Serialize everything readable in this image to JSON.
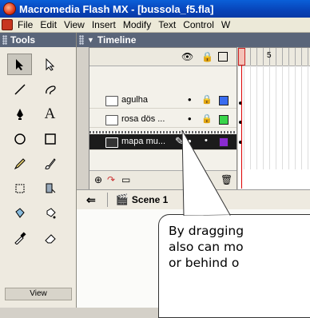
{
  "window": {
    "title": "Macromedia Flash MX - [bussola_f5.fla]"
  },
  "menubar": {
    "items": [
      "File",
      "Edit",
      "View",
      "Insert",
      "Modify",
      "Text",
      "Control",
      "W"
    ]
  },
  "tools_panel": {
    "title": "Tools",
    "view_label": "View",
    "tools": [
      "arrow-icon",
      "subselect-icon",
      "line-icon",
      "lasso-icon",
      "pen-icon",
      "text-icon",
      "oval-icon",
      "rectangle-icon",
      "pencil-icon",
      "brush-icon",
      "free-transform-icon",
      "fill-transform-icon",
      "ink-bottle-icon",
      "paint-bucket-icon",
      "eyedropper-icon",
      "eraser-icon"
    ]
  },
  "timeline": {
    "title": "Timeline",
    "ruler_label": "5",
    "layers": [
      {
        "name": "agulha",
        "color": "#3a6cf0",
        "active": false
      },
      {
        "name": "rosa dös ...",
        "color": "#39d54a",
        "active": false
      },
      {
        "name": "mapa mu...",
        "color": "#8a2bd0",
        "active": true
      }
    ]
  },
  "scene": {
    "label": "Scene 1"
  },
  "callout": {
    "lines": [
      "By dragging",
      "also can mo",
      "or behind o"
    ]
  }
}
